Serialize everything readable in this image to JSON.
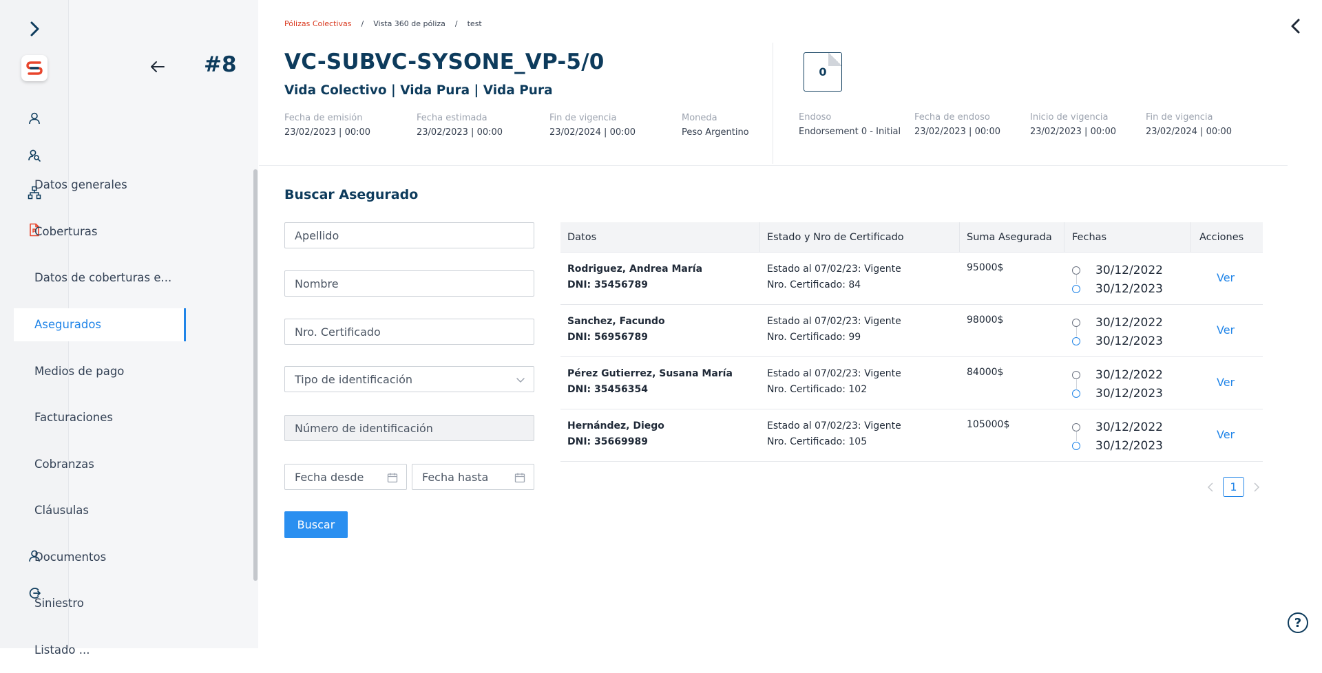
{
  "brand": {
    "logo_letter": "S",
    "accent": "#2185e8",
    "brand_red": "#d9381e",
    "navy": "#0d3b5c"
  },
  "rail": {
    "icons": [
      "chevron-right-icon",
      "user-icon",
      "users-search-icon",
      "hierarchy-icon",
      "pdf-file-icon",
      "user-icon",
      "logout-icon"
    ]
  },
  "nav": {
    "policy_number": "#8",
    "items": [
      {
        "label": "Datos generales",
        "active": false
      },
      {
        "label": "Coberturas",
        "active": false
      },
      {
        "label": "Datos de coberturas e...",
        "active": false
      },
      {
        "label": "Asegurados",
        "active": true
      },
      {
        "label": "Medios de pago",
        "active": false
      },
      {
        "label": "Facturaciones",
        "active": false
      },
      {
        "label": "Cobranzas",
        "active": false
      },
      {
        "label": "Cláusulas",
        "active": false
      },
      {
        "label": "Documentos",
        "active": false
      },
      {
        "label": "Siniestro",
        "active": false
      },
      {
        "label": "Listado ...",
        "active": false
      }
    ]
  },
  "header": {
    "breadcrumb": [
      "Pólizas Colectivas",
      "Vista 360 de póliza",
      "test"
    ],
    "breadcrumb_sep": "/",
    "title": "VC-SUBVC-SYSONE_VP-5/0",
    "subtitle": "Vida Colectivo | Vida Pura | Vida Pura",
    "documents_count": "0",
    "meta_left": [
      {
        "label": "Fecha de emisión",
        "value": "23/02/2023 | 00:00"
      },
      {
        "label": "Fecha estimada",
        "value": "23/02/2023 | 00:00"
      },
      {
        "label": "Fin de vigencia",
        "value": "23/02/2024 | 00:00"
      },
      {
        "label": "Moneda",
        "value": "Peso Argentino"
      }
    ],
    "meta_right": [
      {
        "label": "Endoso",
        "value": "Endorsement 0 - Initial"
      },
      {
        "label": "Fecha de endoso",
        "value": "23/02/2023 | 00:00"
      },
      {
        "label": "Inicio de vigencia",
        "value": "23/02/2023 | 00:00"
      },
      {
        "label": "Fin de vigencia",
        "value": "23/02/2024 | 00:00"
      }
    ]
  },
  "search": {
    "title": "Buscar Asegurado",
    "apellido_placeholder": "Apellido",
    "nombre_placeholder": "Nombre",
    "certificado_placeholder": "Nro. Certificado",
    "tipo_id_label": "Tipo de identificación",
    "numero_id_placeholder": "Número de identificación",
    "fecha_desde": "Fecha desde",
    "fecha_hasta": "Fecha hasta",
    "button": "Buscar"
  },
  "table": {
    "columns": [
      "Datos",
      "Estado y Nro de Certificado",
      "Suma Asegurada",
      "Fechas",
      "Acciones"
    ],
    "rows": [
      {
        "name": "Rodriguez, Andrea María",
        "dni": "DNI: 35456789",
        "estado": "Estado al 07/02/23: Vigente",
        "certificado": "Nro. Certificado: 84",
        "suma": "95000$",
        "fecha_inicio": "30/12/2022",
        "fecha_fin": "30/12/2023",
        "action": "Ver"
      },
      {
        "name": "Sanchez, Facundo",
        "dni": "DNI: 56956789",
        "estado": "Estado al 07/02/23: Vigente",
        "certificado": "Nro. Certificado: 99",
        "suma": "98000$",
        "fecha_inicio": "30/12/2022",
        "fecha_fin": "30/12/2023",
        "action": "Ver"
      },
      {
        "name": "Pérez Gutierrez, Susana María",
        "dni": "DNI: 35456354",
        "estado": "Estado al 07/02/23: Vigente",
        "certificado": "Nro. Certificado: 102",
        "suma": "84000$",
        "fecha_inicio": "30/12/2022",
        "fecha_fin": "30/12/2023",
        "action": "Ver"
      },
      {
        "name": "Hernández, Diego",
        "dni": "DNI: 35669989",
        "estado": "Estado al 07/02/23: Vigente",
        "certificado": "Nro. Certificado: 105",
        "suma": "105000$",
        "fecha_inicio": "30/12/2022",
        "fecha_fin": "30/12/2023",
        "action": "Ver"
      }
    ],
    "current_page": "1"
  },
  "help": {
    "glyph": "?"
  }
}
